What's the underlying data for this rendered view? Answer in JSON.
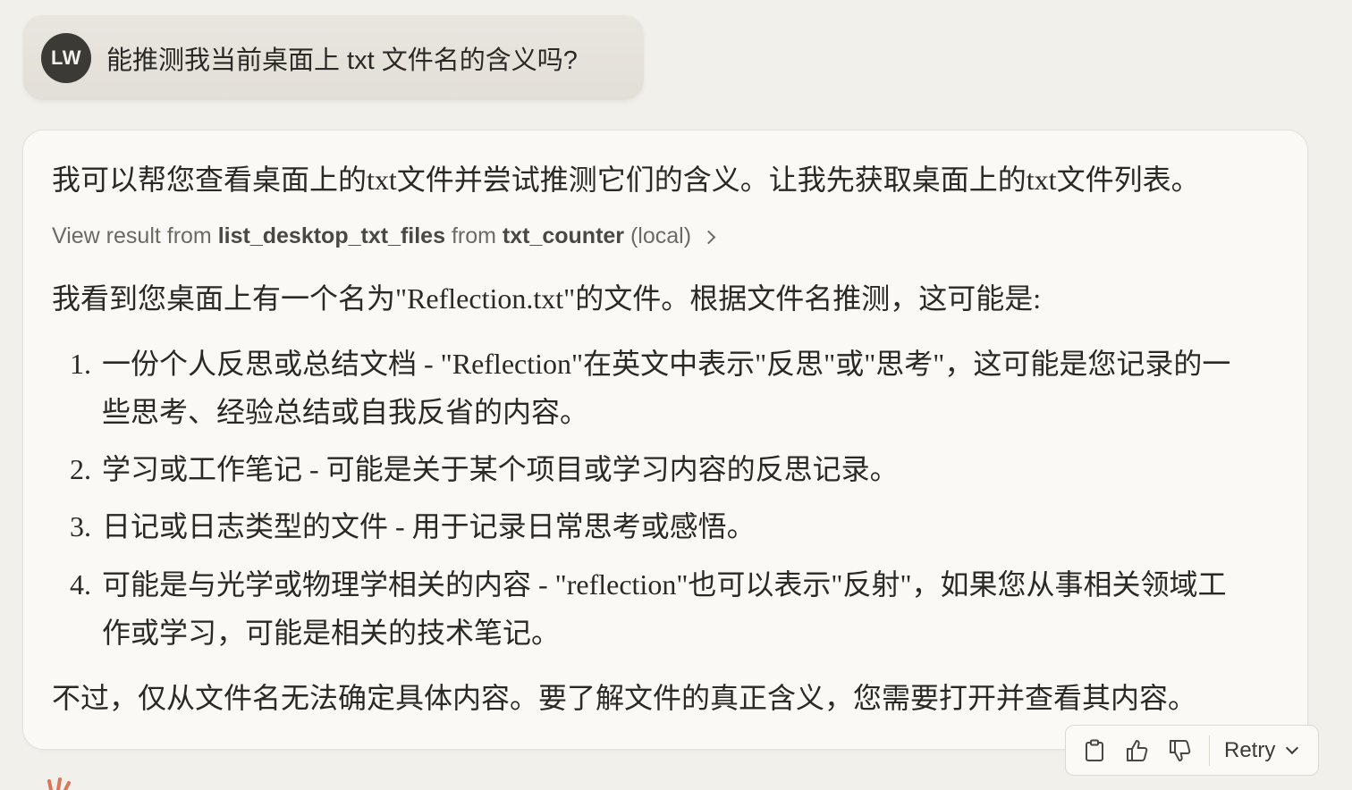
{
  "user_message": {
    "avatar_initials": "LW",
    "text": "能推测我当前桌面上 txt 文件名的含义吗?"
  },
  "assistant": {
    "intro": "我可以帮您查看桌面上的txt文件并尝试推测它们的含义。让我先获取桌面上的txt文件列表。",
    "tool_result": {
      "prefix": "View result from",
      "tool_name": "list_desktop_txt_files",
      "middle": "from",
      "server_name": "txt_counter",
      "suffix": "(local)"
    },
    "para2": "我看到您桌面上有一个名为\"Reflection.txt\"的文件。根据文件名推测，这可能是:",
    "list": [
      {
        "num": "1.",
        "text": "一份个人反思或总结文档 - \"Reflection\"在英文中表示\"反思\"或\"思考\"，这可能是您记录的一些思考、经验总结或自我反省的内容。"
      },
      {
        "num": "2.",
        "text": "学习或工作笔记 - 可能是关于某个项目或学习内容的反思记录。"
      },
      {
        "num": "3.",
        "text": "日记或日志类型的文件 - 用于记录日常思考或感悟。"
      },
      {
        "num": "4.",
        "text": "可能是与光学或物理学相关的内容 - \"reflection\"也可以表示\"反射\"，如果您从事相关领域工作或学习，可能是相关的技术笔记。"
      }
    ],
    "closing": "不过，仅从文件名无法确定具体内容。要了解文件的真正含义，您需要打开并查看其内容。"
  },
  "actions": {
    "copy_icon": "clipboard-icon",
    "like_icon": "thumbs-up-icon",
    "dislike_icon": "thumbs-down-icon",
    "retry_label": "Retry"
  },
  "colors": {
    "background": "#f2f0eb",
    "card": "#faf9f6",
    "avatar": "#3b3a34",
    "accent_spark": "#d97757"
  }
}
